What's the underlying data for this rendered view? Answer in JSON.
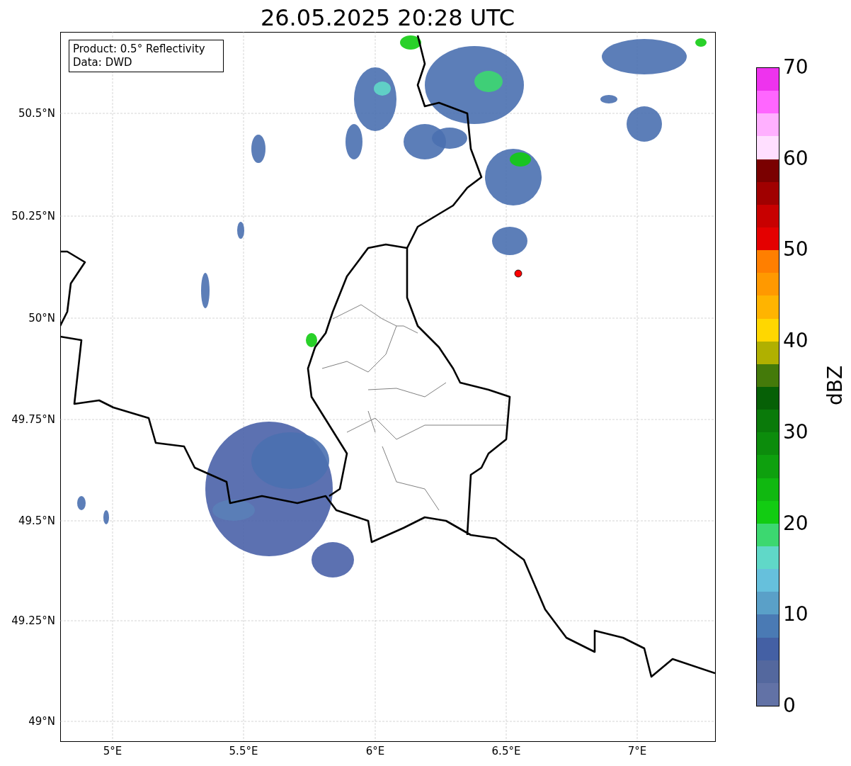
{
  "title": "26.05.2025 20:28 UTC",
  "info_box": {
    "lines": [
      "Product: 0.5° Reflectivity",
      "Data: DWD"
    ]
  },
  "map": {
    "y_ticks": [
      "50.5°N",
      "50.25°N",
      "50°N",
      "49.75°N",
      "49.5°N",
      "49.25°N",
      "49°N"
    ],
    "x_ticks": [
      "5°E",
      "5.5°E",
      "6°E",
      "6.5°E",
      "7°E"
    ]
  },
  "colorbar": {
    "label": "dBZ",
    "ticks": [
      "70",
      "60",
      "50",
      "40",
      "30",
      "20",
      "10",
      "0"
    ],
    "bins": [
      {
        "color": "#6272a6"
      },
      {
        "color": "#54689e"
      },
      {
        "color": "#4460a4"
      },
      {
        "color": "#4a7ab4"
      },
      {
        "color": "#5aa0c8"
      },
      {
        "color": "#66c0dc"
      },
      {
        "color": "#60d8c8"
      },
      {
        "color": "#3cd870"
      },
      {
        "color": "#12cc12"
      },
      {
        "color": "#10b810"
      },
      {
        "color": "#0ea00e"
      },
      {
        "color": "#0c8c0c"
      },
      {
        "color": "#0a7a0a"
      },
      {
        "color": "#066006"
      },
      {
        "color": "#447a0a"
      },
      {
        "color": "#b0b000"
      },
      {
        "color": "#ffd700"
      },
      {
        "color": "#ffb400"
      },
      {
        "color": "#ff9900"
      },
      {
        "color": "#ff7f00"
      },
      {
        "color": "#e40000"
      },
      {
        "color": "#c80000"
      },
      {
        "color": "#a00000"
      },
      {
        "color": "#7a0000"
      },
      {
        "color": "#ffdfff"
      },
      {
        "color": "#ffb0ff"
      },
      {
        "color": "#ff66ff"
      },
      {
        "color": "#ee33ee"
      }
    ]
  }
}
